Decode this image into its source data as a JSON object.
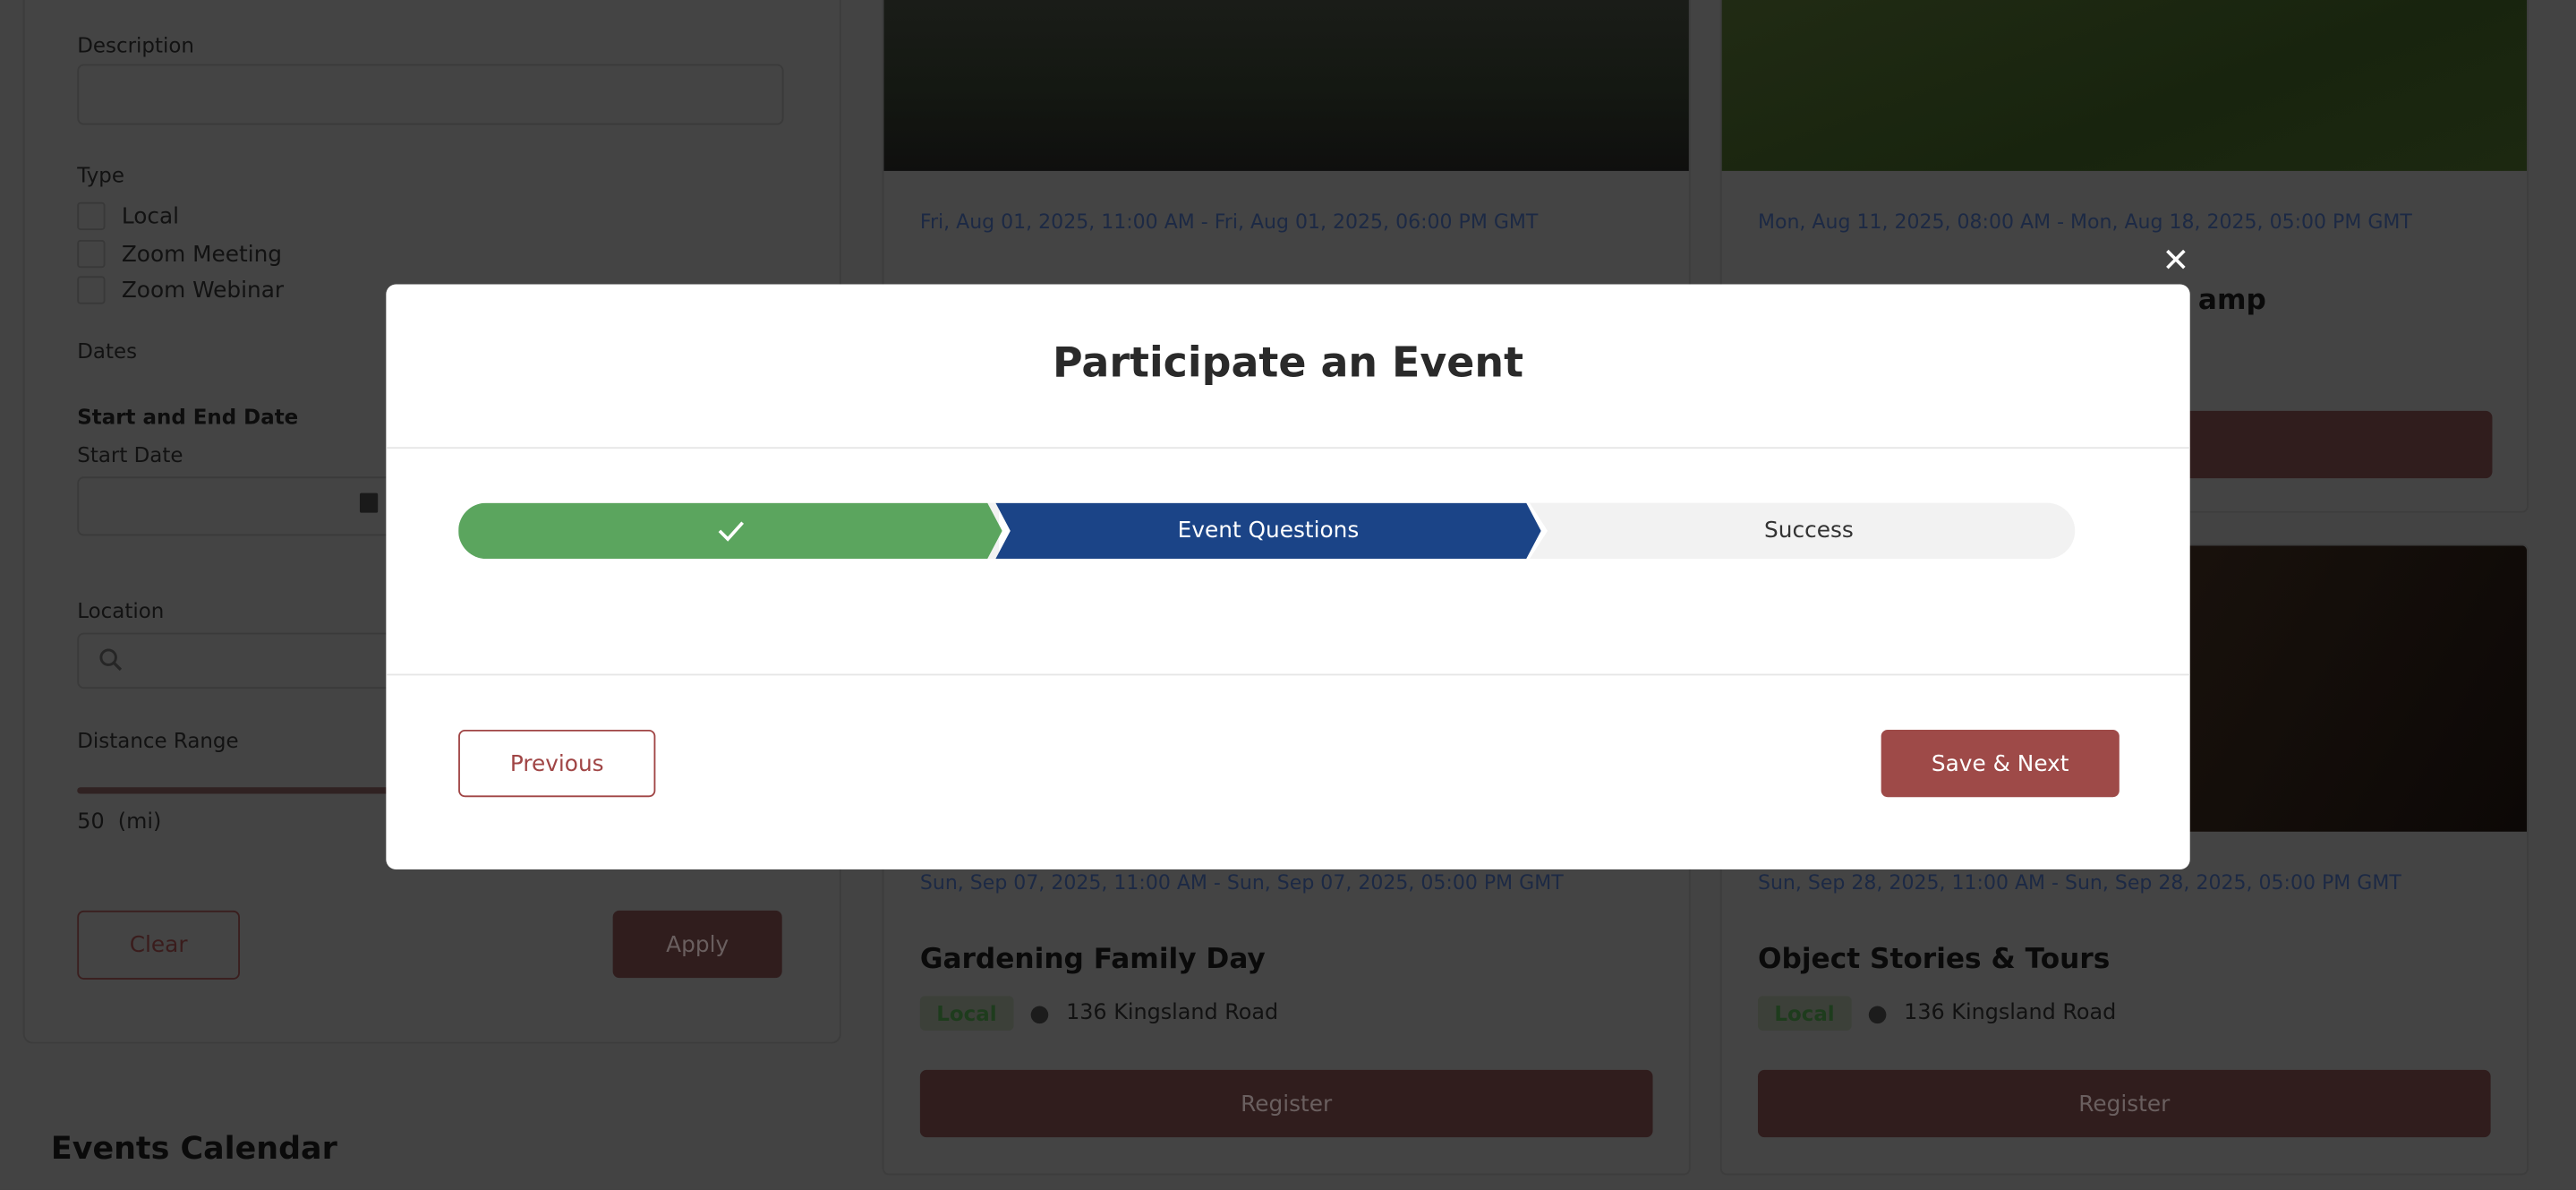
{
  "filters": {
    "description_label": "Description",
    "type_label": "Type",
    "types": [
      "Local",
      "Zoom Meeting",
      "Zoom Webinar"
    ],
    "dates_label": "Dates",
    "start_end_label": "Start and End Date",
    "start_date_label": "Start Date",
    "location_label": "Location",
    "distance_label": "Distance Range",
    "distance_value": "50",
    "distance_unit": "(mi)",
    "clear_label": "Clear",
    "apply_label": "Apply"
  },
  "calendar_title": "Events Calendar",
  "events": [
    {
      "date": "Fri, Aug 01, 2025, 11:00 AM - Fri, Aug 01, 2025, 06:00 PM GMT"
    },
    {
      "date": "Mon, Aug 11, 2025, 08:00 AM - Mon, Aug 18, 2025, 05:00 PM GMT",
      "title_fragment": "amp"
    },
    {
      "date": "Sun, Sep 07, 2025, 11:00 AM - Sun, Sep 07, 2025, 05:00 PM GMT",
      "title": "Gardening Family Day",
      "badge": "Local",
      "address": "136 Kingsland Road",
      "register": "Register"
    },
    {
      "date": "Sun, Sep 28, 2025, 11:00 AM - Sun, Sep 28, 2025, 05:00 PM GMT",
      "title": "Object Stories & Tours",
      "badge": "Local",
      "address": "136 Kingsland Road",
      "register": "Register"
    }
  ],
  "modal": {
    "title": "Participate an Event",
    "steps": [
      {
        "label": "",
        "state": "done",
        "icon": "check-icon"
      },
      {
        "label": "Event Questions",
        "state": "active"
      },
      {
        "label": "Success",
        "state": "pending"
      }
    ],
    "previous_label": "Previous",
    "next_label": "Save & Next",
    "close_icon": "close-icon"
  },
  "colors": {
    "brand": "#9e4a48",
    "step_done": "#5ba55e",
    "step_active": "#1b4487",
    "step_pending": "#f2f2f2",
    "date_text": "#3a5fa8"
  }
}
